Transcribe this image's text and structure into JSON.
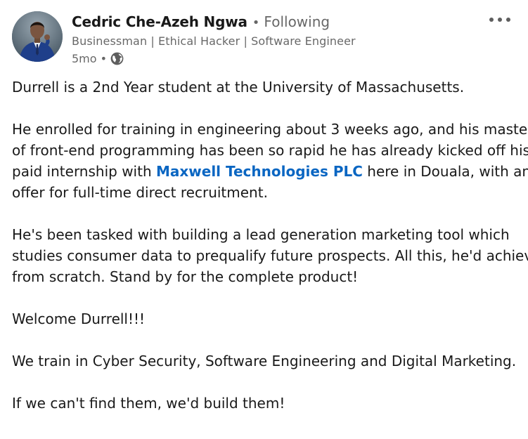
{
  "post": {
    "author": {
      "name": "Cedric Che-Azeh Ngwa",
      "separator": "•",
      "follow_status": "Following",
      "headline": "Businessman | Ethical Hacker | Software Engineer",
      "time": "5mo",
      "visibility_icon": "globe-icon"
    },
    "more_icon": "ellipsis-icon",
    "body": {
      "p1": "Durrell is a 2nd Year student at the University of Massachusetts.",
      "p2_line1": "He enrolled for training in engineering about 3 weeks ago, and his mastery",
      "p2_line2": "of front-end programming has been so rapid he has already kicked off his",
      "p2_line3_before": "paid internship with ",
      "p2_link": "Maxwell Technologies PLC",
      "p2_line3_after": " here in Douala, with an",
      "p2_line4": "offer for full-time direct recruitment.",
      "p3_line1": "He's been tasked with building a lead generation marketing tool which",
      "p3_line2": "studies consumer data to prequalify future prospects. All this, he'd achieve",
      "p3_line3": "from scratch. Stand by for the complete product!",
      "p4": "Welcome Durrell!!!",
      "p5": "We train in Cyber Security, Software Engineering and Digital Marketing.",
      "p6": "If we can't find them, we'd build them!"
    }
  },
  "colors": {
    "link": "#0a66c2",
    "text": "#1f1f1f",
    "secondary": "#666666"
  }
}
